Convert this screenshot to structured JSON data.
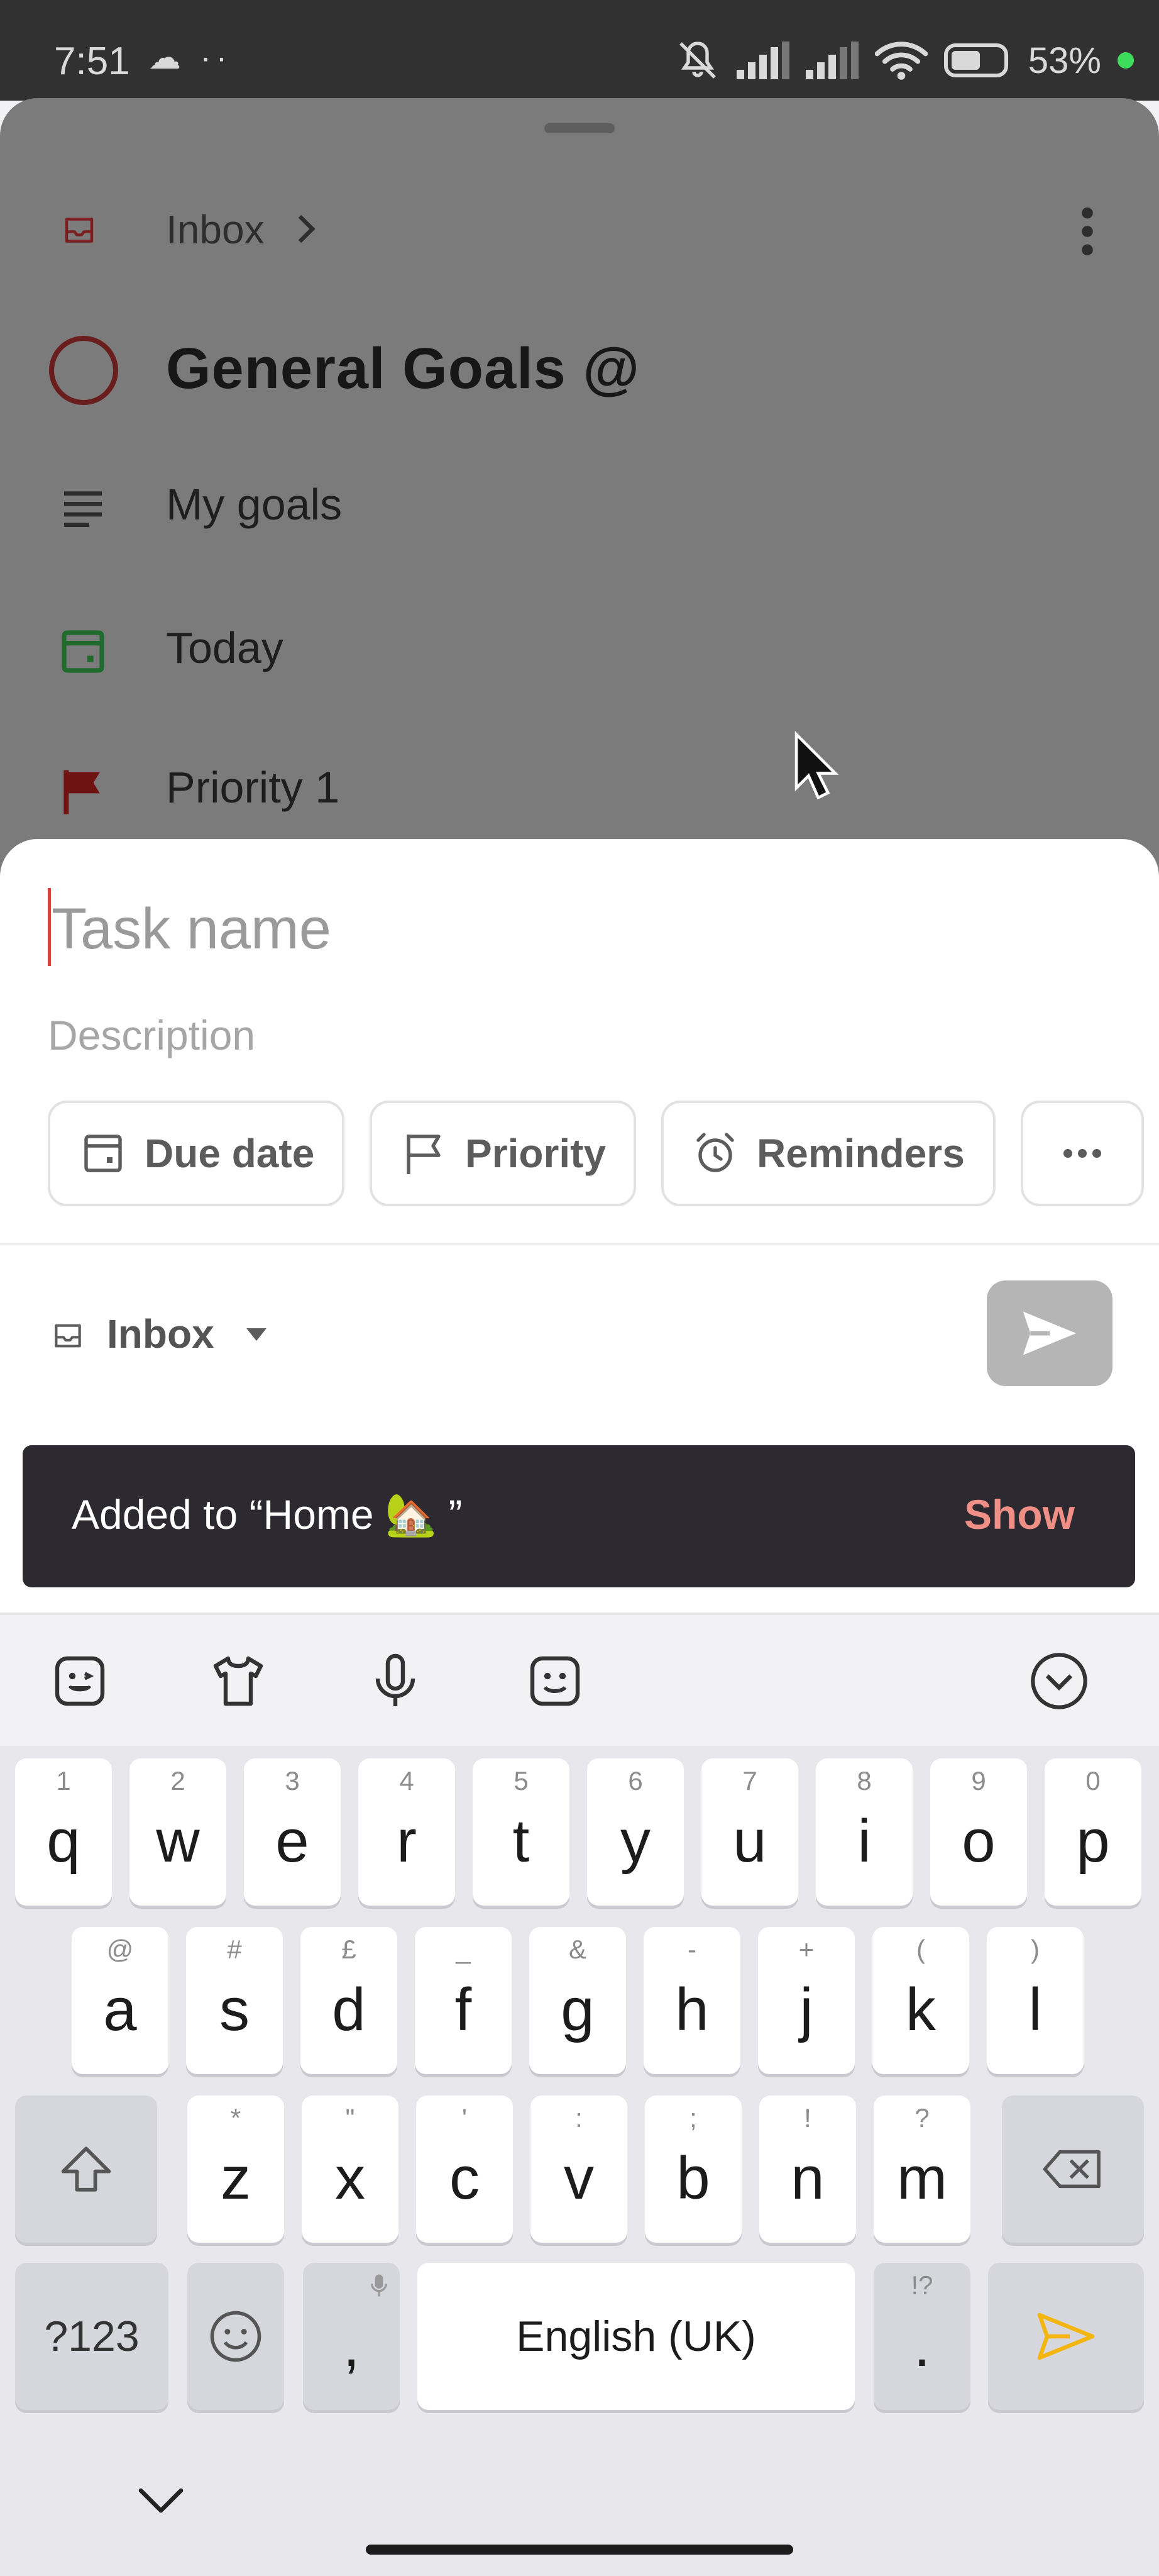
{
  "status_bar": {
    "time": "7:51",
    "left_icons": "☁ ··",
    "battery": "53%",
    "icons": [
      "mute-icon",
      "signal-icon",
      "signal-icon",
      "wifi-icon",
      "battery-icon"
    ]
  },
  "background_sheet": {
    "breadcrumb": "Inbox",
    "task_title": "General Goals @",
    "rows": [
      {
        "label": "My goals",
        "icon": "description-lines-icon"
      },
      {
        "label": "Today",
        "icon": "calendar-icon",
        "color": "#1f7a32"
      },
      {
        "label": "Priority 1",
        "icon": "flag-icon",
        "color": "#7d1414"
      }
    ]
  },
  "composer": {
    "task_placeholder": "Task name",
    "task_value": "",
    "description_placeholder": "Description",
    "chips": {
      "due_date": "Due date",
      "priority": "Priority",
      "reminders": "Reminders",
      "more": "···"
    },
    "project": "Inbox",
    "accent_color": "#d1453b"
  },
  "snackbar": {
    "message": "Added to “Home 🏡 ”",
    "action": "Show"
  },
  "keyboard": {
    "row1": [
      {
        "k": "q",
        "h": "1"
      },
      {
        "k": "w",
        "h": "2"
      },
      {
        "k": "e",
        "h": "3"
      },
      {
        "k": "r",
        "h": "4"
      },
      {
        "k": "t",
        "h": "5"
      },
      {
        "k": "y",
        "h": "6"
      },
      {
        "k": "u",
        "h": "7"
      },
      {
        "k": "i",
        "h": "8"
      },
      {
        "k": "o",
        "h": "9"
      },
      {
        "k": "p",
        "h": "0"
      }
    ],
    "row2": [
      {
        "k": "a",
        "h": "@"
      },
      {
        "k": "s",
        "h": "#"
      },
      {
        "k": "d",
        "h": "£"
      },
      {
        "k": "f",
        "h": "_"
      },
      {
        "k": "g",
        "h": "&"
      },
      {
        "k": "h",
        "h": "-"
      },
      {
        "k": "j",
        "h": "+"
      },
      {
        "k": "k",
        "h": "("
      },
      {
        "k": "l",
        "h": ")"
      }
    ],
    "row3": [
      {
        "k": "z",
        "h": "*"
      },
      {
        "k": "x",
        "h": "\""
      },
      {
        "k": "c",
        "h": "'"
      },
      {
        "k": "v",
        "h": ":"
      },
      {
        "k": "b",
        "h": ";"
      },
      {
        "k": "n",
        "h": "!"
      },
      {
        "k": "m",
        "h": "?"
      }
    ],
    "symbols_label": "?123",
    "comma": ",",
    "space_label": "English (UK)",
    "period": ".",
    "period_hint": "!?",
    "enter_color": "#f5b50f"
  }
}
